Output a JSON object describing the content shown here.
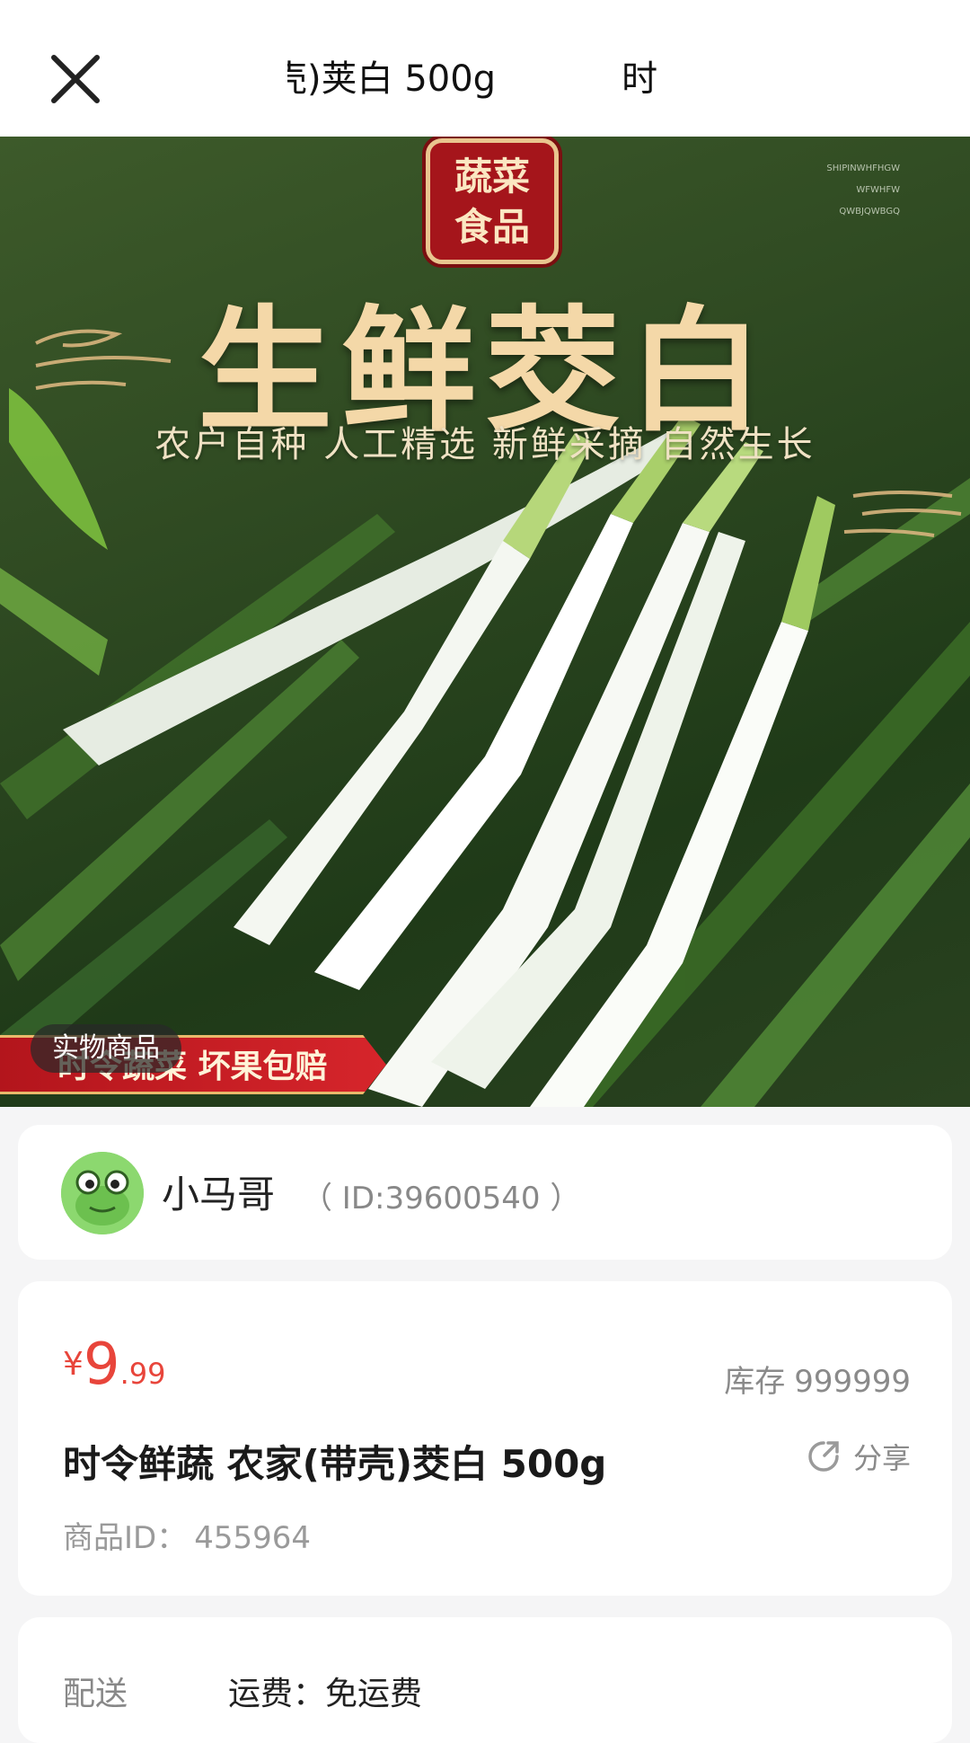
{
  "header": {
    "title_part_visible": ")荚白 500g",
    "title_part_prefix": "壳",
    "title_next_start": "时"
  },
  "hero": {
    "seal_line1": "蔬菜",
    "seal_line2": "食品",
    "title": "生鲜茭白",
    "subtitle": "农户自种  人工精选  新鲜采摘  自然生长",
    "small_text": [
      "SHIPINWHFHGW",
      "WFWHFW",
      "QWBJQWBGQ"
    ],
    "banner": "时令蔬菜 坏果包赔",
    "tag": "实物商品"
  },
  "seller": {
    "name": "小马哥",
    "id_text": "（ ID:39600540 ）"
  },
  "product": {
    "price_symbol": "¥",
    "price_int": "9",
    "price_dec": ".99",
    "stock_label": "库存",
    "stock_value": "999999",
    "title": "时令鲜蔬 农家(带壳)茭白 500g",
    "share_label": "分享",
    "id_label": "商品ID：",
    "id_value": "455964"
  },
  "delivery": {
    "label": "配送",
    "fee": "运费：免运费"
  },
  "colors": {
    "price": "#e8453b",
    "banner": "#c41a20",
    "avatar_bg": "#7fd36a"
  }
}
